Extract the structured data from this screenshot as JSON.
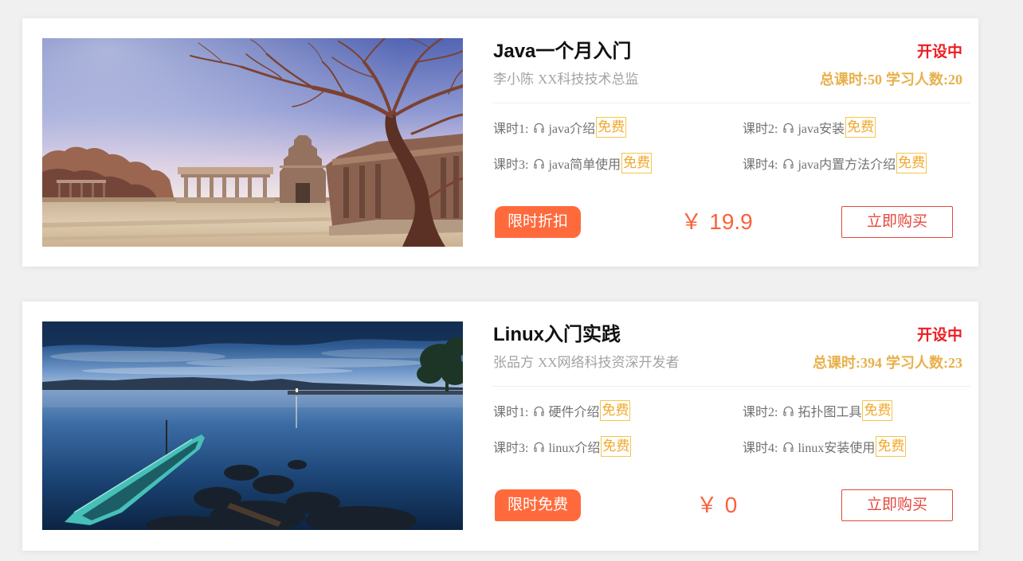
{
  "colors": {
    "page_bg": "#f0f0f0",
    "status": "#ee1d23",
    "stats": "#e8b04a",
    "free_tag": "#f1a82a",
    "free_border": "#f3c64a",
    "promo_bg": "#ff6a3d",
    "price": "#f8623c",
    "buy": "#e5473d"
  },
  "icons": {
    "lesson": "headphones-icon"
  },
  "courses": [
    {
      "title": "Java一个月入门",
      "status": "开设中",
      "teacher_name": "李小陈",
      "teacher_title": "XX科技技术总监",
      "hours_label": "总课时:",
      "hours": "50",
      "learners_label": "学习人数:",
      "learners": "20",
      "lessons": [
        {
          "label": "课时1:",
          "name": "java介绍",
          "tag": "免费"
        },
        {
          "label": "课时2:",
          "name": "java安装",
          "tag": "免费"
        },
        {
          "label": "课时3:",
          "name": "java简单使用",
          "tag": "免费"
        },
        {
          "label": "课时4:",
          "name": "java内置方法介绍",
          "tag": "免费"
        }
      ],
      "promo": "限时折扣",
      "currency": "￥",
      "price": "19.9",
      "buy_label": "立即购买"
    },
    {
      "title": "Linux入门实践",
      "status": "开设中",
      "teacher_name": "张品方",
      "teacher_title": "XX网络科技资深开发者",
      "hours_label": "总课时:",
      "hours": "394",
      "learners_label": "学习人数:",
      "learners": "23",
      "lessons": [
        {
          "label": "课时1:",
          "name": "硬件介绍",
          "tag": "免费"
        },
        {
          "label": "课时2:",
          "name": "拓扑图工具",
          "tag": "免费"
        },
        {
          "label": "课时3:",
          "name": "linux介绍",
          "tag": "免费"
        },
        {
          "label": "课时4:",
          "name": "linux安装使用",
          "tag": "免费"
        }
      ],
      "promo": "限时免费",
      "currency": "￥",
      "price": "0",
      "buy_label": "立即购买"
    }
  ]
}
